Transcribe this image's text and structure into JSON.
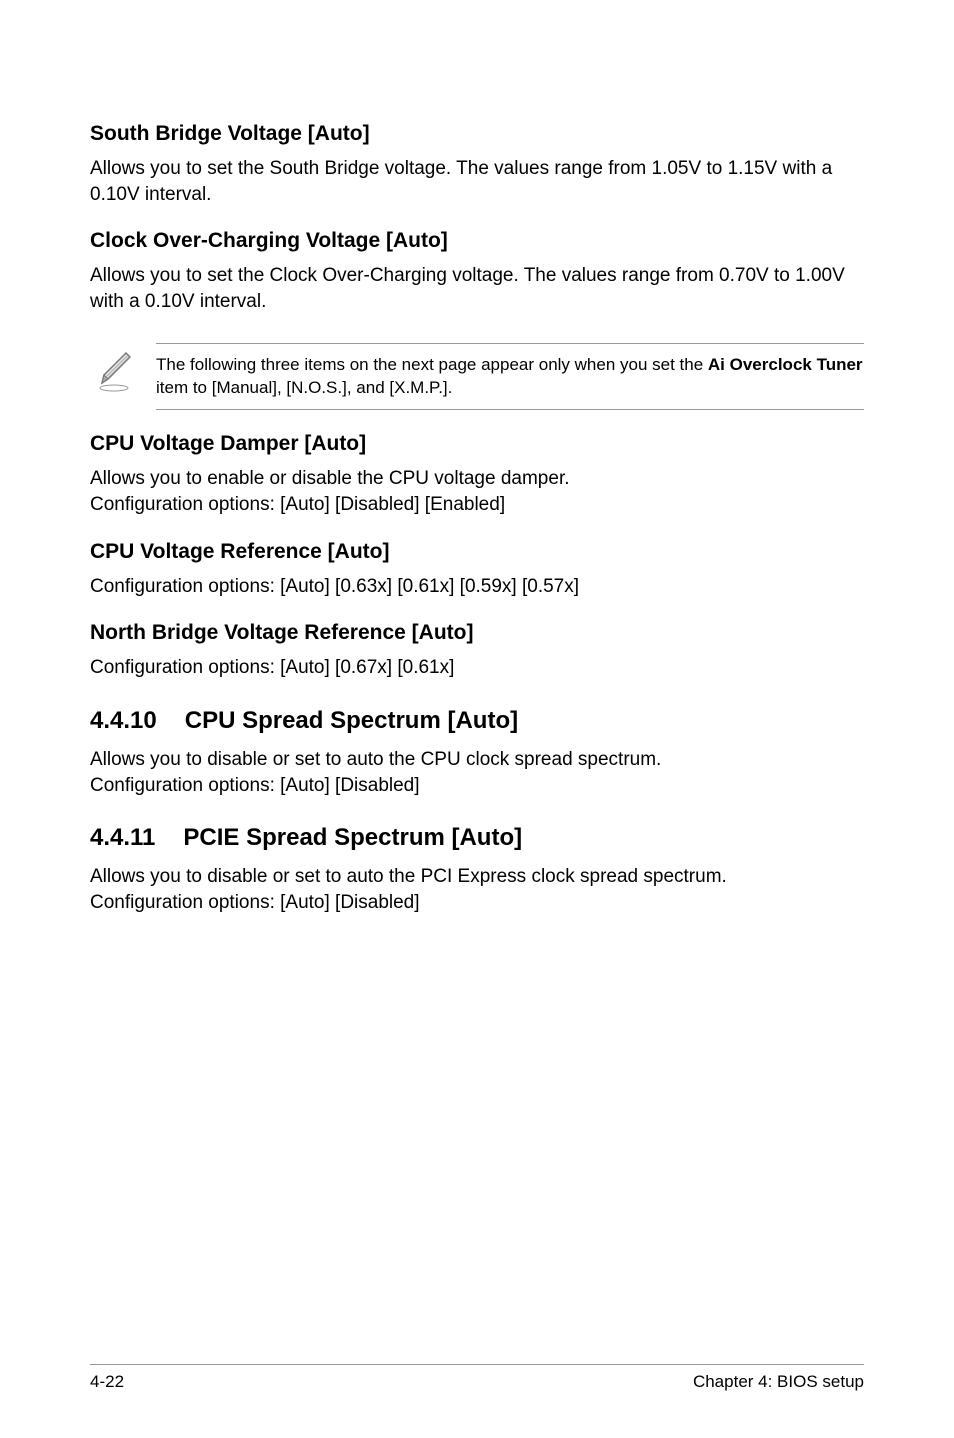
{
  "sections": {
    "southBridge": {
      "heading": "South Bridge Voltage [Auto]",
      "body": "Allows you to set the South Bridge voltage. The values range from 1.05V to 1.15V with a 0.10V interval."
    },
    "clockOver": {
      "heading": "Clock Over-Charging Voltage [Auto]",
      "body": "Allows you to set the Clock Over-Charging voltage. The values range from 0.70V to 1.00V with a 0.10V interval."
    },
    "note": {
      "prefix": "The following three items on the next page appear only when you set the ",
      "bold": "Ai Overclock Tuner",
      "suffix": " item to [Manual], [N.O.S.], and [X.M.P.]."
    },
    "cpuDamper": {
      "heading": "CPU Voltage Damper [Auto]",
      "body1": "Allows you to enable or disable the CPU voltage damper.",
      "body2": "Configuration options: [Auto] [Disabled] [Enabled]"
    },
    "cpuRef": {
      "heading": "CPU Voltage Reference [Auto]",
      "body": "Configuration options: [Auto] [0.63x] [0.61x] [0.59x] [0.57x]"
    },
    "nbRef": {
      "heading": "North Bridge Voltage Reference [Auto]",
      "body": "Configuration options: [Auto] [0.67x] [0.61x]"
    },
    "s4410": {
      "num": "4.4.10",
      "title": "CPU Spread Spectrum [Auto]",
      "body1": "Allows you to disable or set to auto the CPU clock spread spectrum.",
      "body2": "Configuration options: [Auto] [Disabled]"
    },
    "s4411": {
      "num": "4.4.11",
      "title": "PCIE Spread Spectrum [Auto]",
      "body1": "Allows you to disable or set to auto the PCI Express clock spread spectrum.",
      "body2": "Configuration options: [Auto] [Disabled]"
    }
  },
  "footer": {
    "left": "4-22",
    "right": "Chapter 4: BIOS setup"
  }
}
